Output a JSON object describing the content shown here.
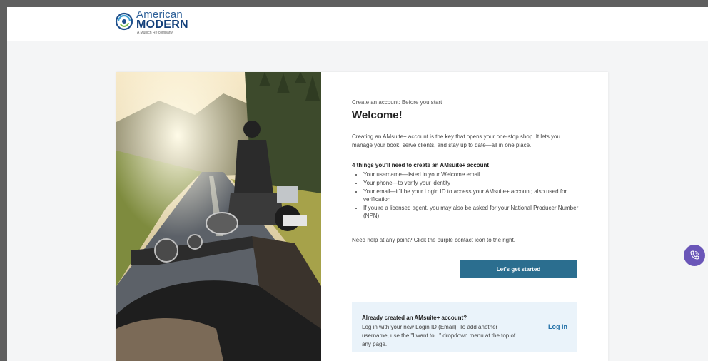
{
  "header": {
    "logo": {
      "line1": "American",
      "line2": "MODERN",
      "tagline": "A Munich Re company"
    }
  },
  "card": {
    "eyebrow": "Create an account: Before you start",
    "title": "Welcome!",
    "intro": "Creating an AMsuite+ account is the key that opens your one-stop shop. It lets you manage your book, serve clients, and stay up to date—all in one place.",
    "needs_heading": "4 things you'll need to create an AMsuite+ account",
    "needs": [
      "Your username—listed in your Welcome email",
      "Your phone—to verify your identity",
      "Your email—it'll be your Login ID to access your AMsuite+ account; also used for verification",
      "If you're a licensed agent, you may also be asked for your National Producer Number (NPN)"
    ],
    "help_text": "Need help at any point? Click the purple contact icon to the right.",
    "start_button": "Let's get started",
    "existing": {
      "title": "Already created an AMsuite+ account?",
      "body": "Log in with your new Login ID (Email). To add another username, use the \"I want to...\" dropdown menu at the top of any page.",
      "login_link": "Log in"
    }
  },
  "contact_button": {
    "icon": "phone-contact-icon",
    "color": "#6a56b8"
  },
  "colors": {
    "primary_button": "#2b6e8f",
    "link": "#1f6ea6",
    "info_box": "#eaf3fa"
  }
}
